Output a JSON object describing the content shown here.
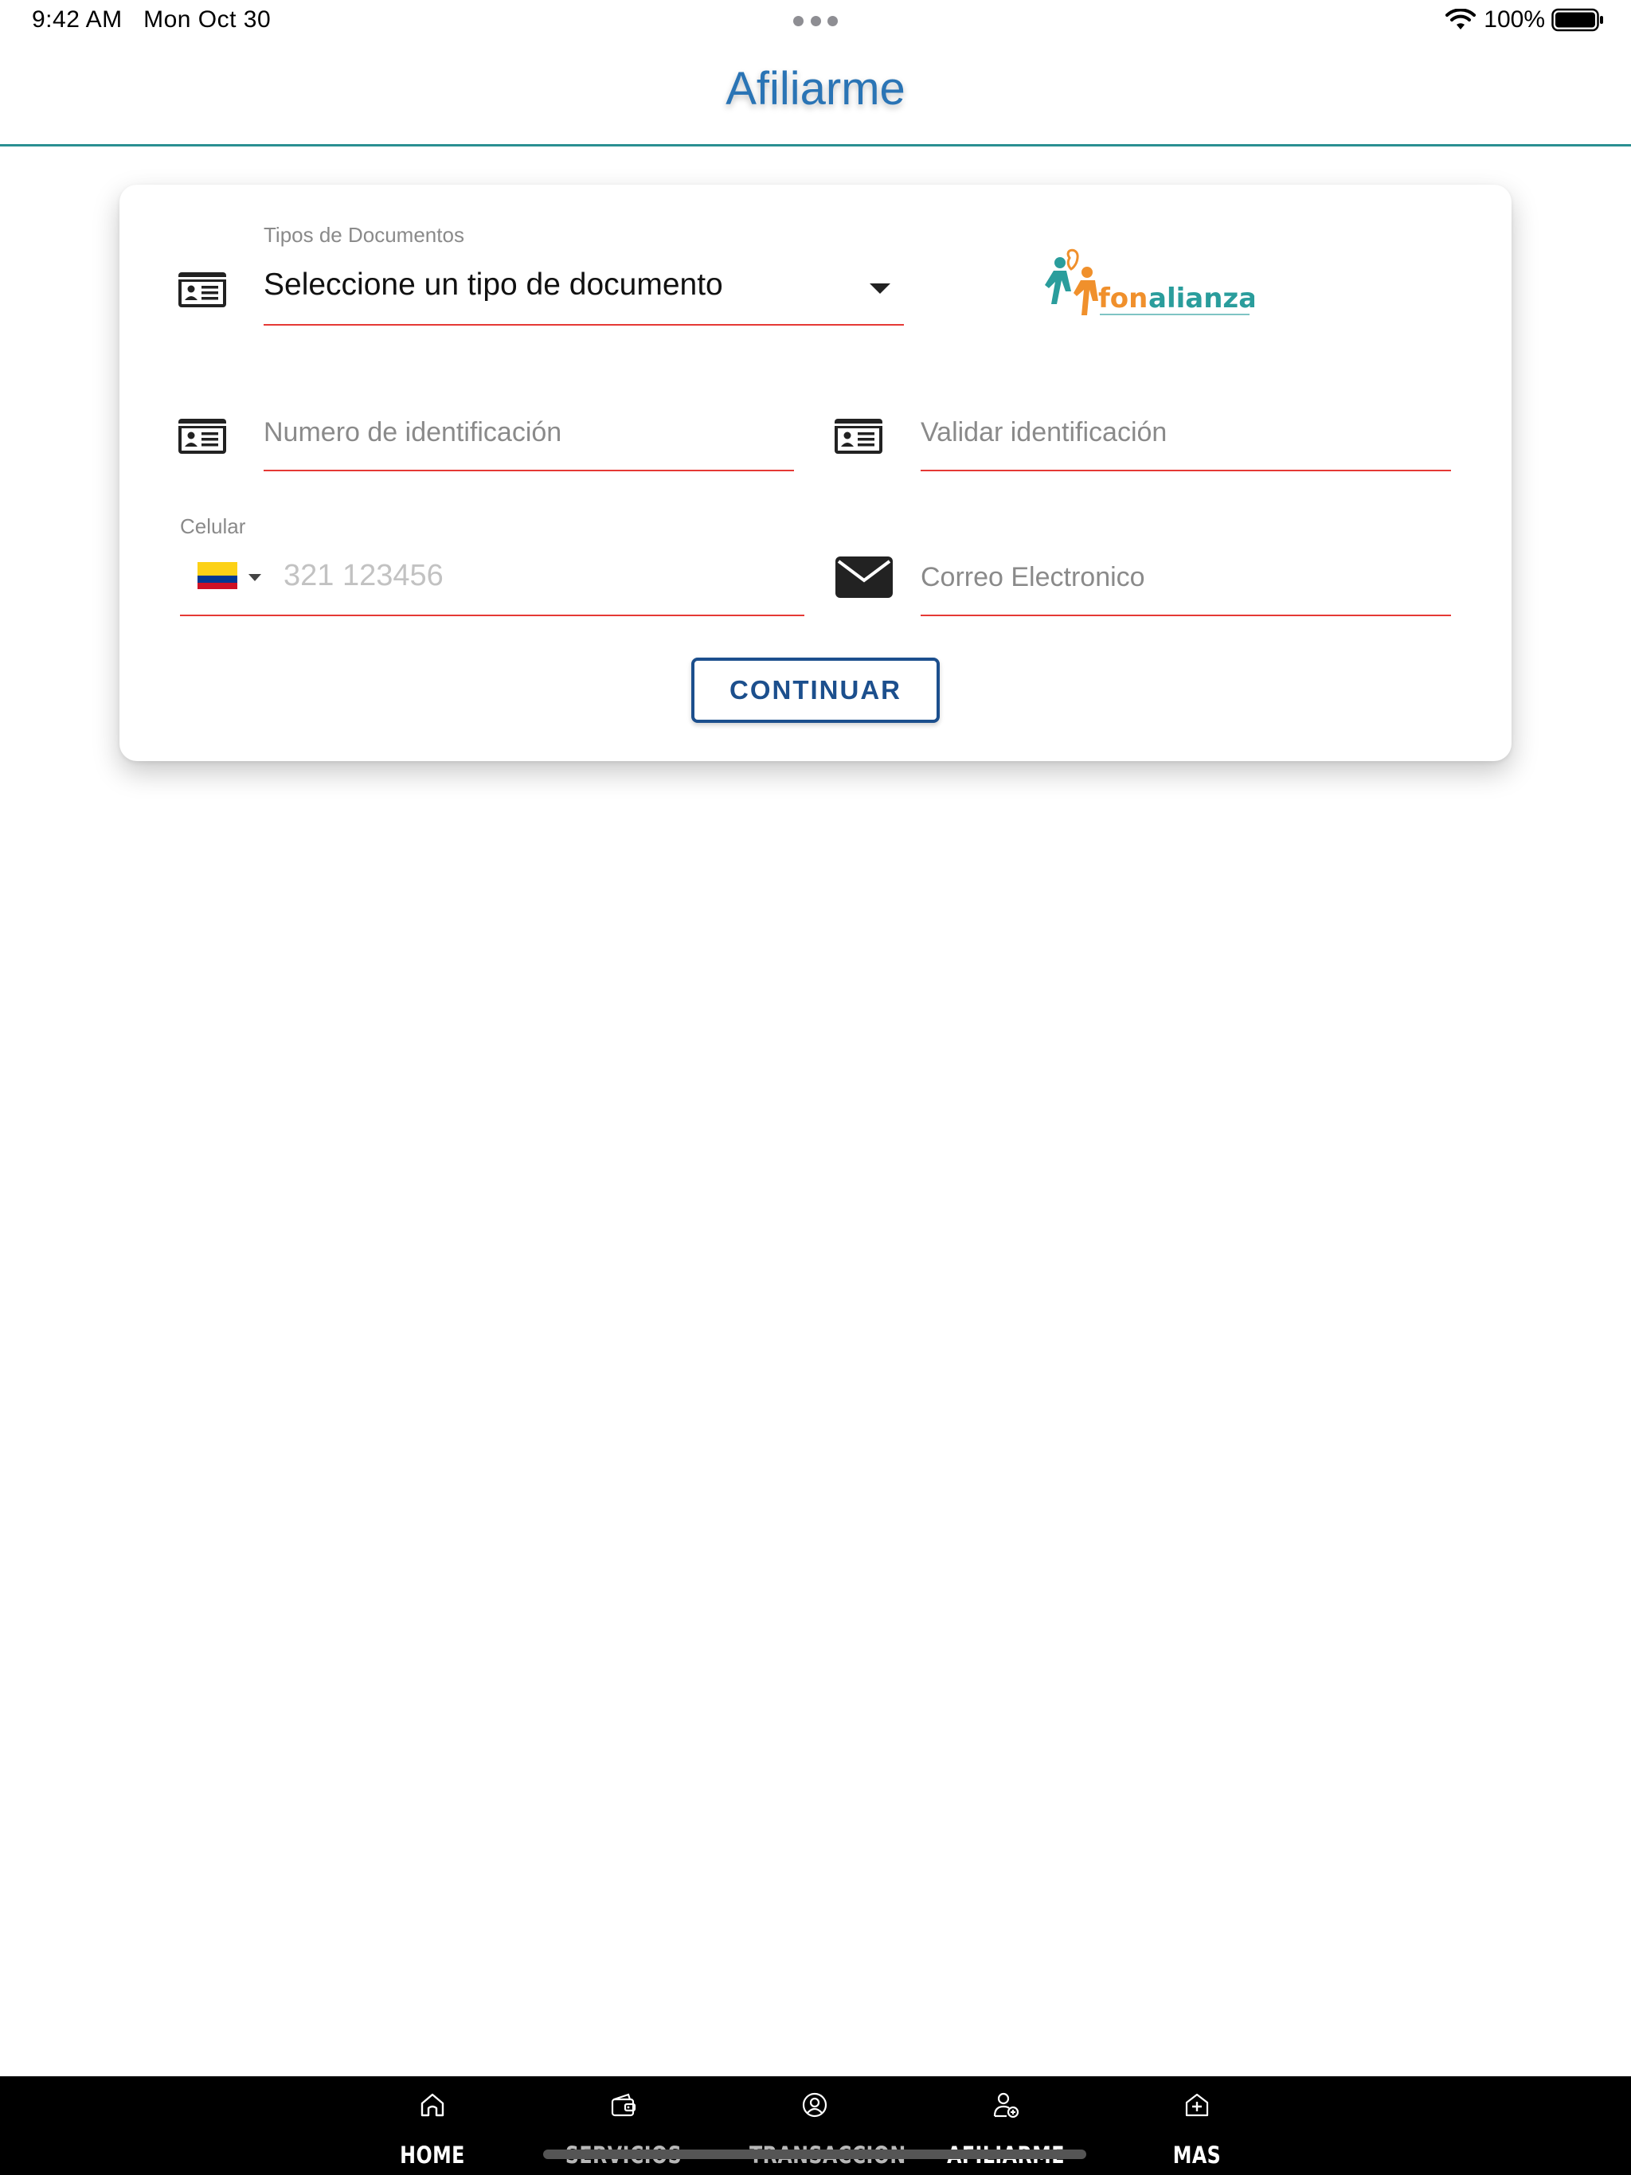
{
  "status_bar": {
    "time": "9:42 AM",
    "date": "Mon Oct 30",
    "battery": "100%"
  },
  "header": {
    "title": "Afiliarme"
  },
  "form": {
    "document_type": {
      "label": "Tipos de Documentos",
      "value": "Seleccione un tipo de documento",
      "icon": "id-card-icon"
    },
    "logo_text": "fonalianza",
    "id_number": {
      "placeholder": "Numero de identificación",
      "icon": "id-card-icon"
    },
    "id_validate": {
      "placeholder": "Validar identificación",
      "icon": "id-card-icon"
    },
    "phone": {
      "label": "Celular",
      "placeholder": "321 123456",
      "country": "CO"
    },
    "email": {
      "placeholder": "Correo Electronico",
      "icon": "envelope-icon"
    },
    "continue_label": "CONTINUAR"
  },
  "bottom_nav": {
    "items": [
      {
        "label": "HOME",
        "icon": "home-icon"
      },
      {
        "label": "SERVICIOS",
        "icon": "wallet-icon"
      },
      {
        "label": "TRANSACCION",
        "icon": "user-circle-icon"
      },
      {
        "label": "AFILIARME",
        "icon": "user-add-icon"
      },
      {
        "label": "MAS",
        "icon": "plus-house-icon"
      }
    ]
  },
  "colors": {
    "title": "#2a74b5",
    "header_line": "#2a8f92",
    "field_underline": "#e53935",
    "button": "#1c4f8d",
    "nav_background": "#000000"
  }
}
